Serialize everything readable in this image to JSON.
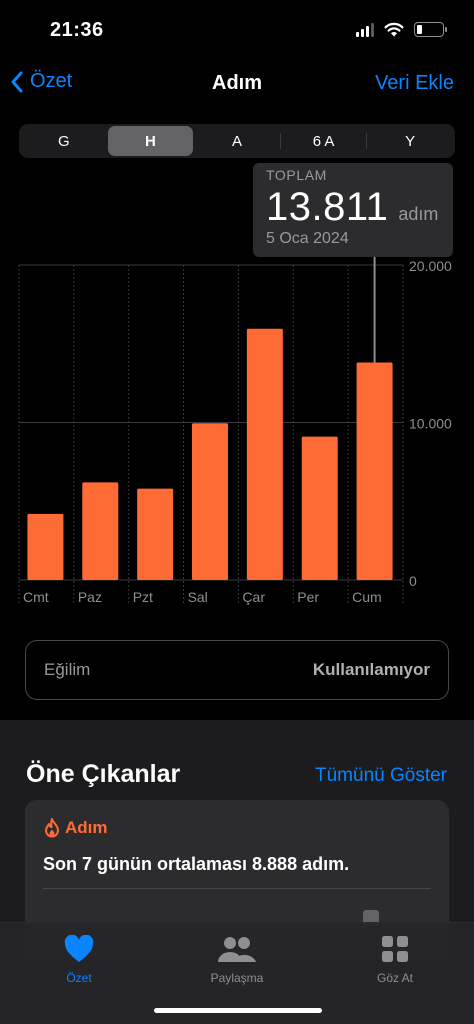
{
  "status": {
    "time": "21:36"
  },
  "nav": {
    "back_label": "Özet",
    "title": "Adım",
    "action_label": "Veri Ekle"
  },
  "range_tabs": [
    "G",
    "H",
    "A",
    "6 A",
    "Y"
  ],
  "selected_range": "H",
  "tooltip": {
    "label": "TOPLAM",
    "value": "13.811",
    "unit": "adım",
    "date": "5 Oca 2024"
  },
  "chart_data": {
    "type": "bar",
    "categories": [
      "Cmt",
      "Paz",
      "Pzt",
      "Sal",
      "Çar",
      "Per",
      "Cum"
    ],
    "values": [
      4200,
      6200,
      5800,
      9950,
      15950,
      9100,
      13811
    ],
    "ylim": [
      0,
      20000
    ],
    "y_ticks": [
      "0",
      "10.000",
      "20.000"
    ],
    "color": "#ff6b35",
    "highlighted_index": 6,
    "grid": true
  },
  "trend": {
    "label": "Eğilim",
    "value": "Kullanılamıyor"
  },
  "highlights": {
    "title": "Öne Çıkanlar",
    "show_all": "Tümünü Göster",
    "card_title": "Adım",
    "card_text": "Son 7 günün ortalaması 8.888 adım."
  },
  "tabbar": [
    {
      "label": "Özet",
      "icon": "heart-icon",
      "active": true
    },
    {
      "label": "Paylaşma",
      "icon": "people-icon",
      "active": false
    },
    {
      "label": "Göz At",
      "icon": "grid-icon",
      "active": false
    }
  ],
  "colors": {
    "accent": "#0a84ff",
    "bar": "#ff6b35"
  }
}
